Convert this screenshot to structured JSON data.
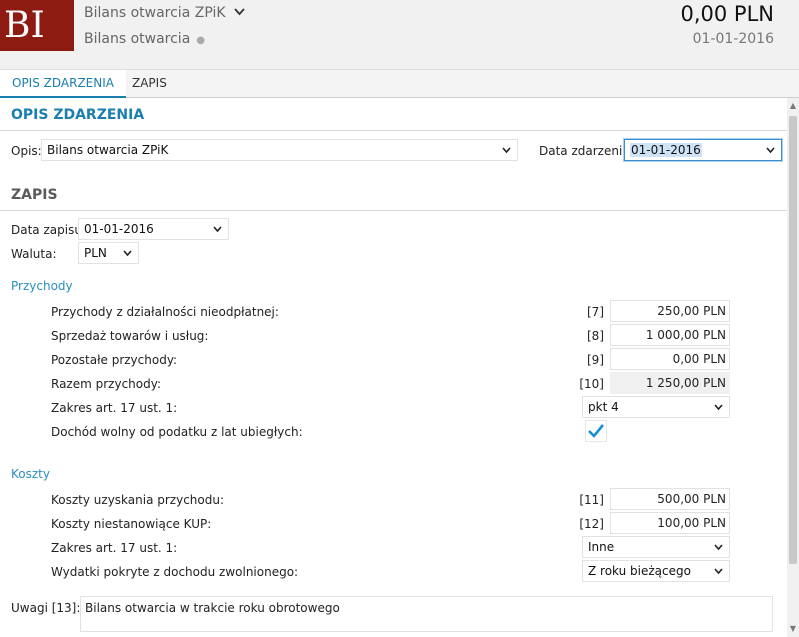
{
  "header": {
    "logo": "BI",
    "doc_type": "Bilans otwarcia ZPiK",
    "doc_title": "Bilans otwarcia",
    "amount": "0,00 PLN",
    "date": "01-01-2016"
  },
  "tabs": [
    {
      "label": "OPIS ZDARZENIA"
    },
    {
      "label": "ZAPIS"
    }
  ],
  "opis_section": {
    "title": "OPIS ZDARZENIA",
    "opis_label": "Opis:",
    "opis_value": "Bilans otwarcia ZPiK",
    "data_label": "Data zdarzenia:",
    "data_value": "01-01-2016"
  },
  "zapis_section": {
    "title": "ZAPIS",
    "data_zapisu_label": "Data zapisu:",
    "data_zapisu_value": "01-01-2016",
    "waluta_label": "Waluta:",
    "waluta_value": "PLN"
  },
  "przychody": {
    "title": "Przychody",
    "rows": [
      {
        "label": "Przychody z działalności nieodpłatnej:",
        "code": "[7]",
        "value": "250,00 PLN"
      },
      {
        "label": "Sprzedaż towarów i usług:",
        "code": "[8]",
        "value": "1 000,00 PLN"
      },
      {
        "label": "Pozostałe przychody:",
        "code": "[9]",
        "value": "0,00 PLN"
      },
      {
        "label": "Razem przychody:",
        "code": "[10]",
        "value": "1 250,00 PLN"
      }
    ],
    "zakres_label": "Zakres art. 17 ust. 1:",
    "zakres_value": "pkt 4",
    "dochod_label": "Dochód wolny od podatku z lat ubiegłych:",
    "dochod_checked": true
  },
  "koszty": {
    "title": "Koszty",
    "rows": [
      {
        "label": "Koszty uzyskania przychodu:",
        "code": "[11]",
        "value": "500,00 PLN"
      },
      {
        "label": "Koszty niestanowiące KUP:",
        "code": "[12]",
        "value": "100,00 PLN"
      }
    ],
    "zakres_label": "Zakres art. 17 ust. 1:",
    "zakres_value": "Inne",
    "wydatki_label": "Wydatki pokryte z dochodu zwolnionego:",
    "wydatki_value": "Z roku bieżącego"
  },
  "uwagi": {
    "label": "Uwagi [13]:",
    "value": "Bilans otwarcia w trakcie roku obrotowego"
  },
  "icons": {
    "dropdown": "chevron-down-icon",
    "check": "checkmark-icon"
  },
  "colors": {
    "logo_bg": "#8e1b12",
    "accent": "#1a7fb0",
    "check": "#1a8fd0"
  }
}
